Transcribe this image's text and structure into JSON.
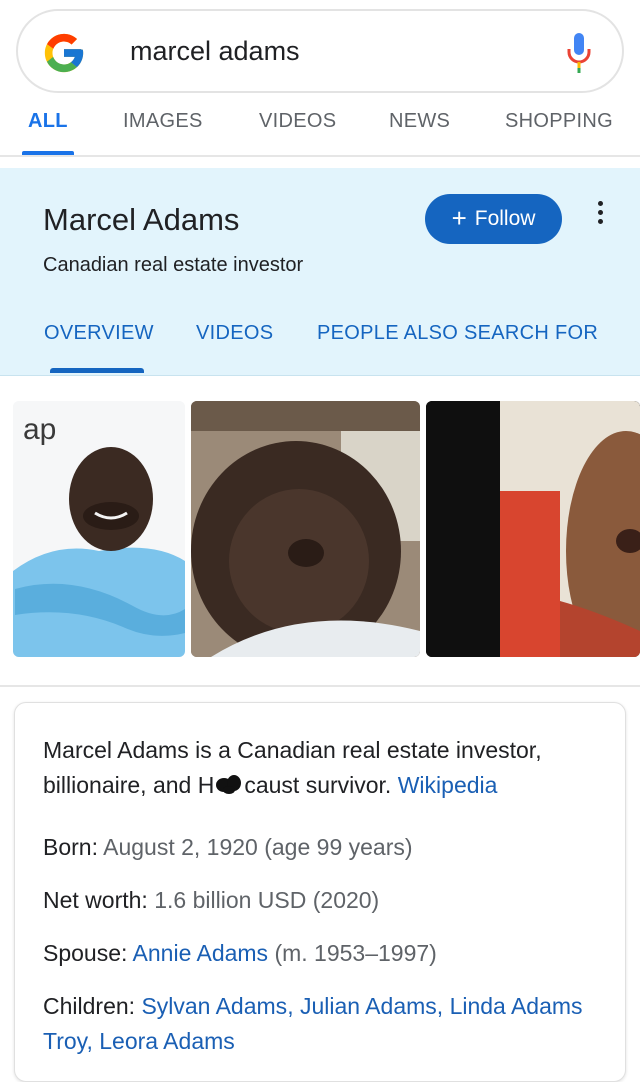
{
  "search": {
    "query": "marcel adams",
    "logo_icon": "google-g-icon",
    "mic_icon": "microphone-icon"
  },
  "tabs": [
    {
      "label": "ALL",
      "active": true
    },
    {
      "label": "IMAGES",
      "active": false
    },
    {
      "label": "VIDEOS",
      "active": false
    },
    {
      "label": "NEWS",
      "active": false
    },
    {
      "label": "SHOPPING",
      "active": false
    }
  ],
  "knowledge_panel": {
    "title": "Marcel Adams",
    "subtitle": "Canadian real estate investor",
    "follow_label": "Follow",
    "tabs": [
      {
        "label": "OVERVIEW",
        "active": true
      },
      {
        "label": "VIDEOS",
        "active": false
      },
      {
        "label": "PEOPLE ALSO SEARCH FOR",
        "active": false
      }
    ]
  },
  "images": {
    "logo_text": "ap"
  },
  "description": {
    "text_before": "Marcel Adams is a Canadian real estate investor, billionaire, and H",
    "text_after": "caust survivor.",
    "source_link": "Wikipedia"
  },
  "facts": {
    "born_label": "Born:",
    "born_value": "August 2, 1920 (age 99 years)",
    "net_worth_label": "Net worth:",
    "net_worth_value": "1.6 billion USD (2020)",
    "spouse_label": "Spouse:",
    "spouse_link": "Annie Adams",
    "spouse_value": "(m. 1953–1997)",
    "children_label": "Children:",
    "children_links": [
      "Sylvan Adams",
      "Julian Adams",
      "Linda Adams Troy",
      "Leora Adams"
    ]
  },
  "colors": {
    "accent_blue": "#1a73e8",
    "panel_bg": "#e2f4fc",
    "follow_bg": "#1565c0",
    "link": "#1a5fb4"
  }
}
